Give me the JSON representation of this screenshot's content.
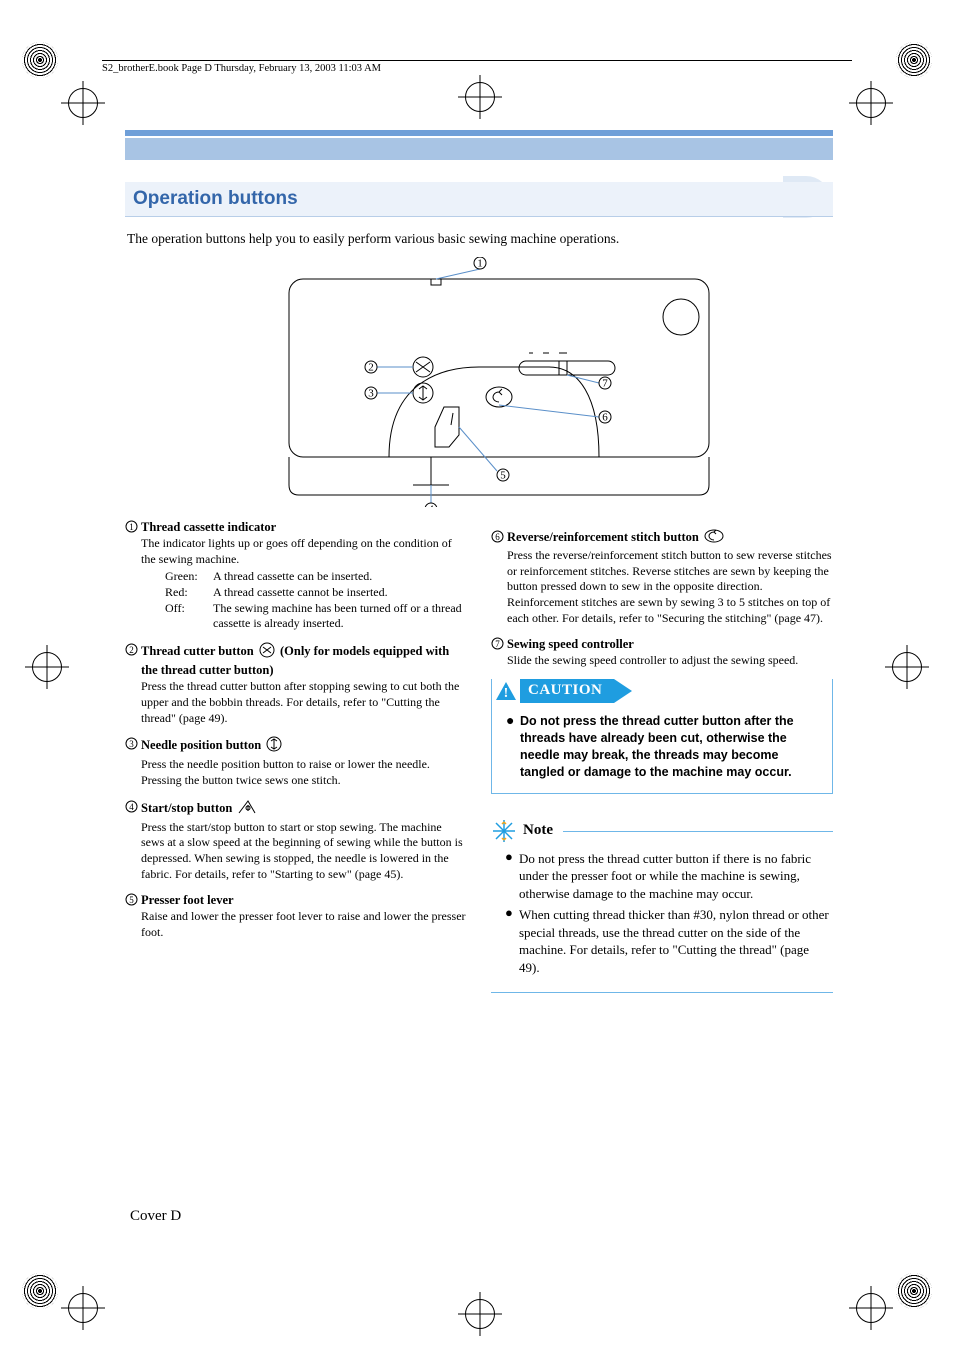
{
  "header_line": "S2_brotherE.book  Page D  Thursday, February 13, 2003  11:03 AM",
  "section_title": "Operation buttons",
  "intro": "The operation buttons help you to easily perform various basic sewing machine operations.",
  "callouts": {
    "1": "1",
    "2": "2",
    "3": "3",
    "4": "4",
    "5": "5",
    "6": "6",
    "7": "7"
  },
  "items": {
    "1": {
      "title": "Thread cassette indicator",
      "desc": "The indicator lights up or goes off depending on the condition of the sewing machine.",
      "states": {
        "green_label": "Green:",
        "green": "A thread cassette can be inserted.",
        "red_label": "Red:",
        "red": "A thread cassette cannot be inserted.",
        "off_label": "Off:",
        "off": "The sewing machine has been turned off or a thread cassette is already inserted."
      }
    },
    "2": {
      "title_a": "Thread cutter button",
      "title_b": " (Only for models equipped with the thread cutter button)",
      "desc": "Press the thread cutter button after stopping sewing to cut both the upper and the bobbin threads. For details, refer to \"Cutting the thread\" (page 49)."
    },
    "3": {
      "title": "Needle position button",
      "desc": "Press the needle position button to raise or lower the needle. Pressing the button twice sews one stitch."
    },
    "4": {
      "title": "Start/stop button",
      "desc": "Press the start/stop button to start or stop sewing. The machine sews at a slow speed at the beginning of sewing while the button is depressed. When sewing is stopped, the needle is lowered in the fabric. For details, refer to \"Starting to sew\" (page 45)."
    },
    "5": {
      "title": "Presser foot lever",
      "desc": "Raise and lower the presser foot lever to raise and lower the presser foot."
    },
    "6": {
      "title": "Reverse/reinforcement stitch button",
      "desc": "Press the reverse/reinforcement stitch button to sew reverse stitches or reinforcement stitches. Reverse stitches are sewn by keeping the button pressed down to sew in the opposite direction. Reinforcement stitches are sewn by sewing 3 to 5 stitches on top of each other. For details, refer to \"Securing the stitching\" (page 47)."
    },
    "7": {
      "title": "Sewing speed controller",
      "desc": "Slide the sewing speed controller to adjust the sewing speed."
    }
  },
  "caution": {
    "label": "CAUTION",
    "text": "Do not press the thread cutter button after the threads have already been cut, otherwise the needle may break, the threads may become tangled or damage to the machine may occur."
  },
  "note": {
    "label": "Note",
    "items": [
      "Do not press the thread cutter button if there is no fabric under the presser foot or while the machine is sewing, otherwise damage to the machine may occur.",
      "When cutting thread thicker than #30, nylon thread or other special threads, use the thread cutter on the side of the machine. For details, refer to \"Cutting the thread\" (page 49)."
    ]
  },
  "footer": "Cover D"
}
